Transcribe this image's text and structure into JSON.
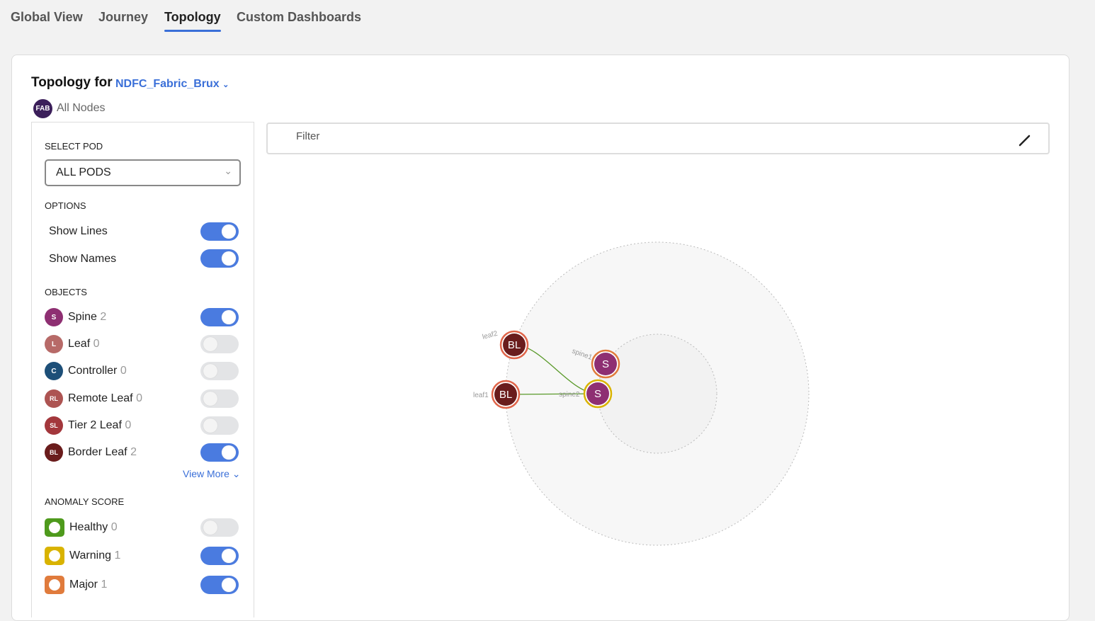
{
  "tabs": [
    {
      "label": "Global View"
    },
    {
      "label": "Journey"
    },
    {
      "label": "Topology",
      "active": true
    },
    {
      "label": "Custom Dashboards"
    }
  ],
  "header": {
    "title": "Topology for",
    "fabric": "NDFC_Fabric_Brux",
    "scope_badge": "FAB",
    "scope_label": "All Nodes"
  },
  "panel": {
    "select_pod_label": "SELECT POD",
    "select_pod_value": "ALL PODS",
    "options_label": "OPTIONS",
    "options": [
      {
        "label": "Show Lines",
        "on": true
      },
      {
        "label": "Show Names",
        "on": true
      }
    ],
    "objects_label": "OBJECTS",
    "objects": [
      {
        "badge": "S",
        "label": "Spine",
        "count": "2",
        "on": true,
        "color": "#8e2f72"
      },
      {
        "badge": "L",
        "label": "Leaf",
        "count": "0",
        "on": false,
        "color": "#b76a68"
      },
      {
        "badge": "C",
        "label": "Controller",
        "count": "0",
        "on": false,
        "color": "#1d4f78"
      },
      {
        "badge": "RL",
        "label": "Remote Leaf",
        "count": "0",
        "on": false,
        "color": "#ad5452"
      },
      {
        "badge": "SL",
        "label": "Tier 2 Leaf",
        "count": "0",
        "on": false,
        "color": "#a3373c"
      },
      {
        "badge": "BL",
        "label": "Border Leaf",
        "count": "2",
        "on": true,
        "color": "#6a1c1c"
      }
    ],
    "view_more": "View More",
    "anomaly_label": "ANOMALY SCORE",
    "anomaly": [
      {
        "label": "Healthy",
        "count": "0",
        "on": false,
        "color": "#4e9a1c",
        "icon": "heartbeat-icon"
      },
      {
        "label": "Warning",
        "count": "1",
        "on": true,
        "color": "#d9b300",
        "icon": "heartbeat-icon"
      },
      {
        "label": "Major",
        "count": "1",
        "on": true,
        "color": "#e07b3c",
        "icon": "heartbeat-icon"
      }
    ]
  },
  "filter": {
    "placeholder": "Filter",
    "icon": "pencil-icon"
  },
  "topology": {
    "nodes": [
      {
        "id": "leaf2",
        "label": "BL",
        "name": "leaf2",
        "fill": "#6a1c1c",
        "ring": "#e0654a"
      },
      {
        "id": "leaf1",
        "label": "BL",
        "name": "leaf1",
        "fill": "#6a1c1c",
        "ring": "#e0654a"
      },
      {
        "id": "spine1",
        "label": "S",
        "name": "spine1",
        "fill": "#8e2f72",
        "ring": "#e07b3c"
      },
      {
        "id": "spine2",
        "label": "S",
        "name": "spine2",
        "fill": "#8e2f72",
        "ring": "#d9b300"
      }
    ],
    "links": [
      {
        "from": "leaf2",
        "to": "spine2"
      },
      {
        "from": "leaf1",
        "to": "spine2"
      }
    ],
    "link_color": "#5a9a2a"
  }
}
